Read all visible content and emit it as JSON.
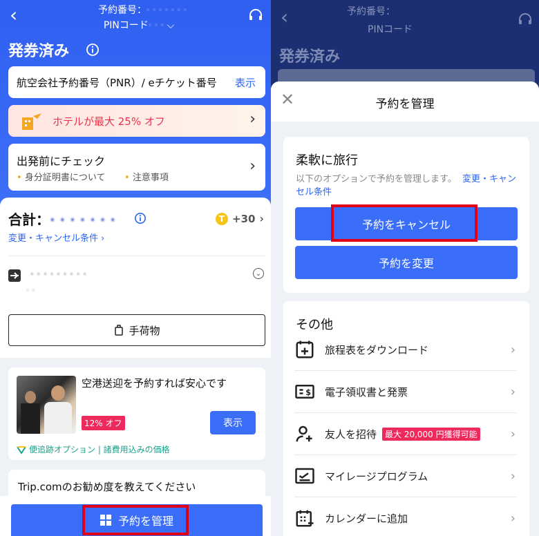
{
  "left": {
    "header": {
      "booking_no_label": "予約番号：",
      "booking_no_value": "· · · · · · ·",
      "pin_label": "PINコード",
      "pin_value": "· · ·",
      "status_title": "発券済み"
    },
    "pnr_card": {
      "label": "航空会社予約番号（PNR）/ eチケット番号",
      "action": "表示"
    },
    "hotel_banner": {
      "text": "ホテルが最大 25% オフ"
    },
    "check_card": {
      "title": "出発前にチェック",
      "item1": "身分証明書について",
      "item2": "注意事項"
    },
    "total": {
      "label": "合計：",
      "value": "· · · · · · ·",
      "points": "+30",
      "link": "変更・キャンセル条件 ›"
    },
    "flight": {
      "line1": "· · · · · · · · ·",
      "line2": "· ·"
    },
    "baggage_button": "手荷物",
    "transfer": {
      "title": "空港送迎を予約すれば安心です",
      "badge": "12% オフ",
      "button": "表示",
      "note": "便追跡オプション | 諸費用込みの価格"
    },
    "survey": {
      "text": "Trip.comのお勧め度を教えてください"
    },
    "manage_button": "予約を管理"
  },
  "right": {
    "bg_header": {
      "booking_no_label": "予約番号：",
      "pin_label": "PINコード",
      "status_title": "発券済み"
    },
    "sheet": {
      "title": "予約を管理",
      "flex_title": "柔軟に旅行",
      "flex_desc": "以下のオプションで予約を管理します。",
      "flex_link": "変更・キャンセル条件",
      "cancel_button": "予約をキャンセル",
      "change_button": "予約を変更",
      "other_title": "その他",
      "items": [
        {
          "label": "旅程表をダウンロード",
          "icon": "itinerary-icon"
        },
        {
          "label": "電子領収書と発票",
          "icon": "receipt-icon"
        },
        {
          "label": "友人を招待",
          "icon": "invite-icon",
          "badge": "最大 20,000 円獲得可能"
        },
        {
          "label": "マイレージプログラム",
          "icon": "mileage-icon"
        },
        {
          "label": "カレンダーに追加",
          "icon": "calendar-icon"
        }
      ]
    }
  }
}
